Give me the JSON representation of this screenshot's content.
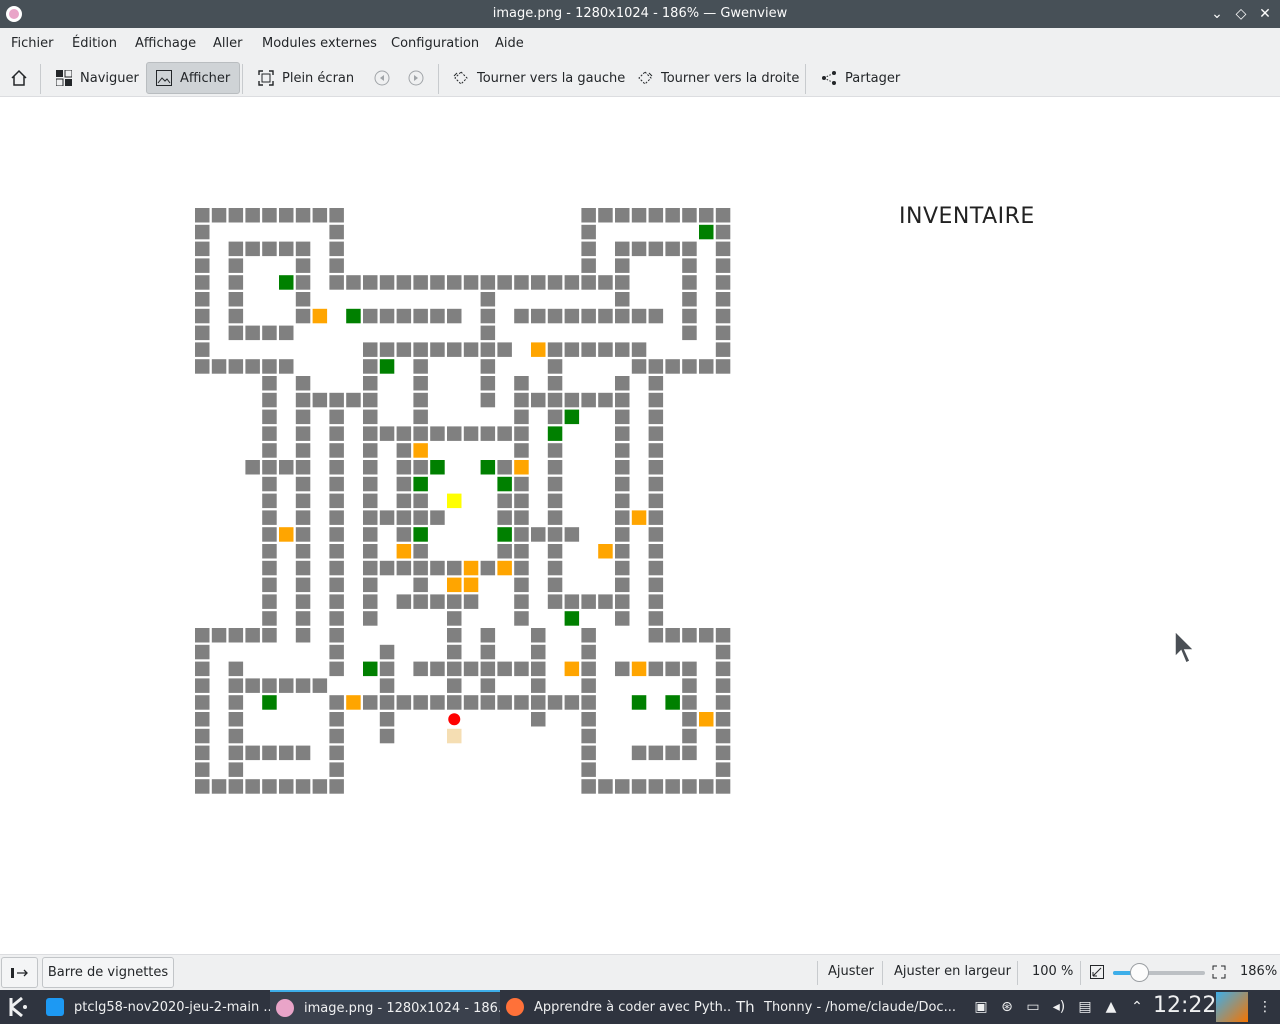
{
  "window": {
    "title": "image.png - 1280x1024 - 186% — Gwenview"
  },
  "menu": [
    "Fichier",
    "Édition",
    "Affichage",
    "Aller",
    "Modules externes",
    "Configuration",
    "Aide"
  ],
  "toolbar": {
    "browse": "Naviguer",
    "view": "Afficher",
    "fullscreen": "Plein écran",
    "rotate_left": "Tourner vers la gauche",
    "rotate_right": "Tourner vers la droite",
    "share": "Partager"
  },
  "image": {
    "inventory_title": "INVENTAIRE",
    "colors": {
      "wall": "#808080",
      "grass": "#008000",
      "orange": "#ffa500",
      "yellow": "#ffff00",
      "player": "#ff0000",
      "exit": "#f5deb3"
    }
  },
  "statusbar": {
    "thumbnail_bar": "Barre de vignettes",
    "fit": "Ajuster",
    "fit_width": "Ajuster en largeur",
    "zoom_100": "100 %",
    "zoom_value": "186%",
    "zoom_slider_level": 0.3
  },
  "taskbar": {
    "tasks": [
      "ptclg58-nov2020-jeu-2-main ...",
      "image.png - 1280x1024 - 186...",
      "Apprendre à coder avec Pyth...",
      "Thonny - /home/claude/Doc..."
    ],
    "clock": "12:22"
  }
}
